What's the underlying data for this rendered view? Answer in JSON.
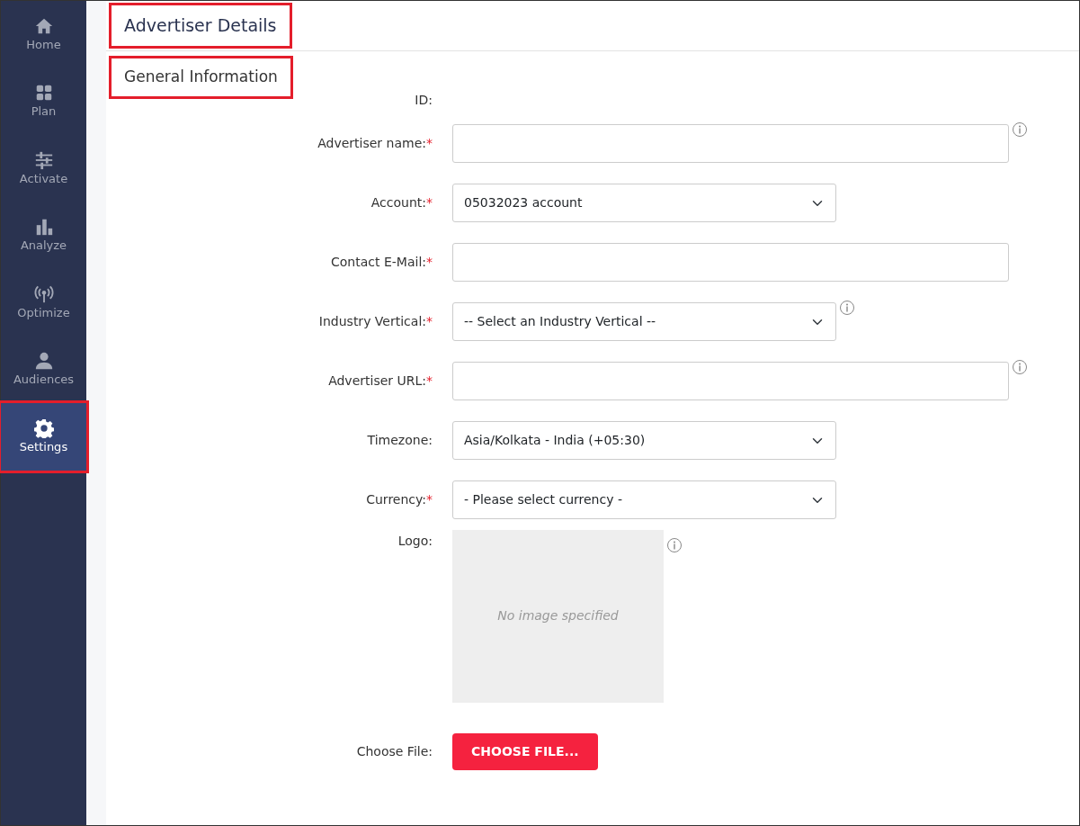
{
  "sidebar": {
    "items": [
      {
        "label": "Home",
        "selected": false,
        "highlighted": false
      },
      {
        "label": "Plan",
        "selected": false,
        "highlighted": false
      },
      {
        "label": "Activate",
        "selected": false,
        "highlighted": false
      },
      {
        "label": "Analyze",
        "selected": false,
        "highlighted": false
      },
      {
        "label": "Optimize",
        "selected": false,
        "highlighted": false
      },
      {
        "label": "Audiences",
        "selected": false,
        "highlighted": false
      },
      {
        "label": "Settings",
        "selected": true,
        "highlighted": true
      }
    ]
  },
  "header": {
    "title": "Advertiser Details",
    "highlighted": true
  },
  "section": {
    "title": "General Information",
    "highlighted": true
  },
  "form": {
    "fields": [
      {
        "kind": "static",
        "label": "ID:",
        "info": false
      },
      {
        "kind": "text",
        "label": "Advertiser name:",
        "required_mark": "*",
        "info": true
      },
      {
        "kind": "select",
        "label": "Account:",
        "required_mark": "*",
        "info": false,
        "value": "05032023 account"
      },
      {
        "kind": "text",
        "label": "Contact E-Mail:",
        "required_mark": "*",
        "info": false
      },
      {
        "kind": "select",
        "label": "Industry Vertical:",
        "required_mark": "*",
        "info": true,
        "value": "-- Select an Industry Vertical --"
      },
      {
        "kind": "text",
        "label": "Advertiser URL:",
        "required_mark": "*",
        "info": true
      },
      {
        "kind": "select",
        "label": "Timezone:",
        "info": false,
        "value": "Asia/Kolkata - India (+05:30)"
      },
      {
        "kind": "select",
        "label": "Currency:",
        "required_mark": "*",
        "info": false,
        "value": "- Please select currency -"
      },
      {
        "kind": "image",
        "label": "Logo:",
        "info": true,
        "placeholder": "No image specified"
      },
      {
        "kind": "file",
        "label": "Choose File:",
        "info": false,
        "button": "CHOOSE FILE..."
      }
    ]
  }
}
